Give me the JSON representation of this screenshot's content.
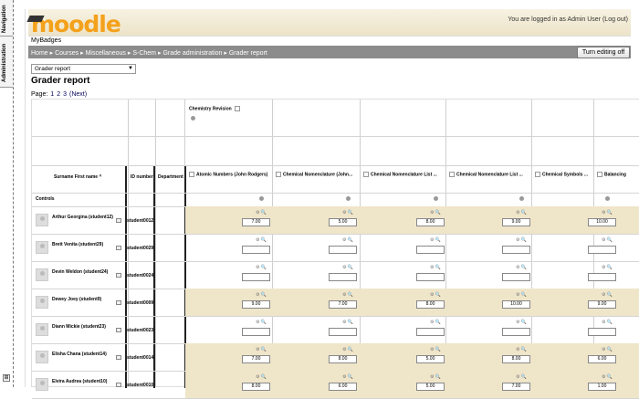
{
  "sidebar": {
    "tab1": "Navigation",
    "tab2": "Administration",
    "dock_icon": "dock-icon"
  },
  "header": {
    "logo": "moodle",
    "login_text": "You are logged in as Admin User (Log out)",
    "site_name": "MyBadges"
  },
  "breadcrumb": {
    "items": [
      "Home",
      "Courses",
      "Miscellaneous",
      "S-Chem",
      "Grade administration",
      "Grader report"
    ],
    "separator": "▸"
  },
  "edit_button": "Turn editing off",
  "report_select": {
    "value": "Grader report"
  },
  "page_title": "Grader report",
  "paging": {
    "label": "Page:",
    "pages": [
      "1",
      "2",
      "3"
    ],
    "next": "(Next)"
  },
  "category": {
    "name": "Chemistry Revision"
  },
  "headers": {
    "name_col": "Surname First name",
    "sort_indicator": "^",
    "id_col": "ID number",
    "dept_col": "Department",
    "controls": "Controls"
  },
  "columns": [
    "Atomic Numbers (John Rodgers)",
    "Chemical Nomenclature (John...",
    "Chemical Nomenclature List ...",
    "Chemical Nomenclature List ...",
    "Chemical Symbols ...",
    "Balancing"
  ],
  "students": [
    {
      "name": "Arthur Georgina (student12)",
      "id": "student0012",
      "grades": [
        "7.00",
        "5.00",
        "8.00",
        "9.00",
        "10.00"
      ],
      "highlight": true
    },
    {
      "name": "Brett Venita (student29)",
      "id": "student0029",
      "grades": [
        "",
        "",
        "",
        "",
        ""
      ],
      "highlight": false
    },
    {
      "name": "Devin Weldon (student24)",
      "id": "student0024",
      "grades": [
        "",
        "",
        "",
        "",
        ""
      ],
      "highlight": false
    },
    {
      "name": "Dewey Joey (student9)",
      "id": "student0009",
      "grades": [
        "9.00",
        "7.00",
        "8.00",
        "10.00",
        "9.00"
      ],
      "highlight": true
    },
    {
      "name": "Diann Mickie (student23)",
      "id": "student0023",
      "grades": [
        "",
        "",
        "",
        "",
        ""
      ],
      "highlight": false
    },
    {
      "name": "Elisha Chana (student14)",
      "id": "student0014",
      "grades": [
        "7.00",
        "8.00",
        "5.00",
        "8.00",
        "6.00"
      ],
      "highlight": true
    },
    {
      "name": "Elvira Audrea (student10)",
      "id": "student0010",
      "grades": [
        "8.00",
        "6.00",
        "5.00",
        "7.00",
        "1.00"
      ],
      "highlight": true
    }
  ],
  "colors": {
    "highlight_row": "#efe5c9",
    "navbar": "#8c8c8c",
    "logo": "#f4a11b"
  }
}
